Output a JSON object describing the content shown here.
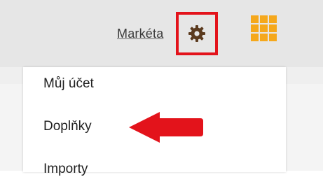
{
  "header": {
    "user_name": "Markéta",
    "settings_icon": "gear-icon",
    "apps_icon": "grid-apps-icon"
  },
  "dropdown": {
    "items": [
      {
        "label": "Můj účet"
      },
      {
        "label": "Doplňky"
      },
      {
        "label": "Importy"
      }
    ]
  },
  "annotations": {
    "highlight_color": "#e3131b",
    "arrow_color": "#e3131b"
  },
  "colors": {
    "accent": "#f5a81c",
    "gear": "#5b3a1e"
  }
}
